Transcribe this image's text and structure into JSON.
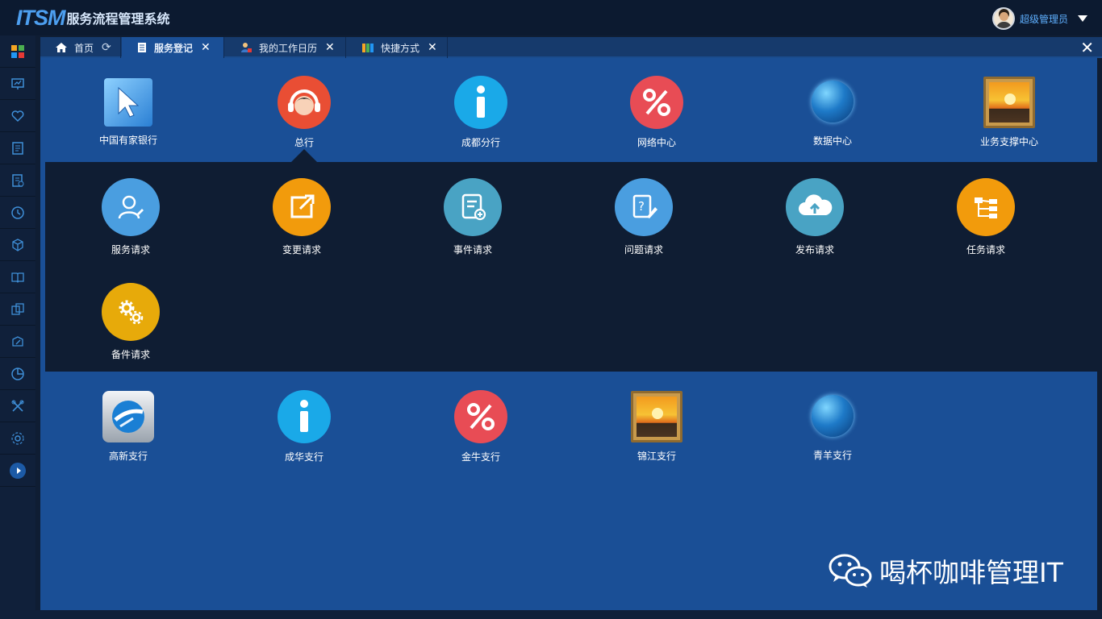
{
  "app": {
    "logo": "ITSM",
    "title": "服务流程管理系统"
  },
  "user": {
    "name": "超级管理员"
  },
  "sidebar_icons": [
    "grid-icon",
    "monitor-icon",
    "heart-icon",
    "document-icon",
    "checklist-icon",
    "clock-icon",
    "cube-icon",
    "book-icon",
    "transfer-icon",
    "box-edit-icon",
    "pie-chart-icon",
    "tools-icon",
    "settings-icon",
    "expand-icon"
  ],
  "tabs": [
    {
      "label": "首页",
      "icon": "home-icon"
    },
    {
      "label": "服务登记",
      "icon": "register-icon"
    },
    {
      "label": "我的工作日历",
      "icon": "calendar-user-icon"
    },
    {
      "label": "快捷方式",
      "icon": "shortcut-icon"
    }
  ],
  "top_row": [
    {
      "label": "中国有家银行",
      "icon": "cursor-icon"
    },
    {
      "label": "总行",
      "icon": "headset-icon"
    },
    {
      "label": "成都分行",
      "icon": "info-icon"
    },
    {
      "label": "网络中心",
      "icon": "percent-icon"
    },
    {
      "label": "数据中心",
      "icon": "globe-icon"
    },
    {
      "label": "业务支撑中心",
      "icon": "picture-icon"
    }
  ],
  "services": [
    {
      "label": "服务请求",
      "icon": "user-service-icon",
      "color": "#4a9ee0"
    },
    {
      "label": "变更请求",
      "icon": "external-link-icon",
      "color": "#f29b0c"
    },
    {
      "label": "事件请求",
      "icon": "add-note-icon",
      "color": "#49a3c4"
    },
    {
      "label": "问题请求",
      "icon": "question-edit-icon",
      "color": "#4a9ee0"
    },
    {
      "label": "发布请求",
      "icon": "cloud-upload-icon",
      "color": "#49a3c4"
    },
    {
      "label": "任务请求",
      "icon": "hierarchy-icon",
      "color": "#f29b0c"
    },
    {
      "label": "备件请求",
      "icon": "gears-icon",
      "color": "#e7aa0a"
    }
  ],
  "bottom_row": [
    {
      "label": "高新支行",
      "icon": "ie-icon"
    },
    {
      "label": "成华支行",
      "icon": "info-icon"
    },
    {
      "label": "金牛支行",
      "icon": "percent-icon"
    },
    {
      "label": "锦江支行",
      "icon": "picture-icon"
    },
    {
      "label": "青羊支行",
      "icon": "globe-icon"
    }
  ],
  "watermark": {
    "text": "喝杯咖啡管理IT"
  },
  "colors": {
    "topbar": "#0c1a30",
    "main": "#1a4f96",
    "panel": "#0f1d33",
    "accent": "#5fb0ff"
  }
}
